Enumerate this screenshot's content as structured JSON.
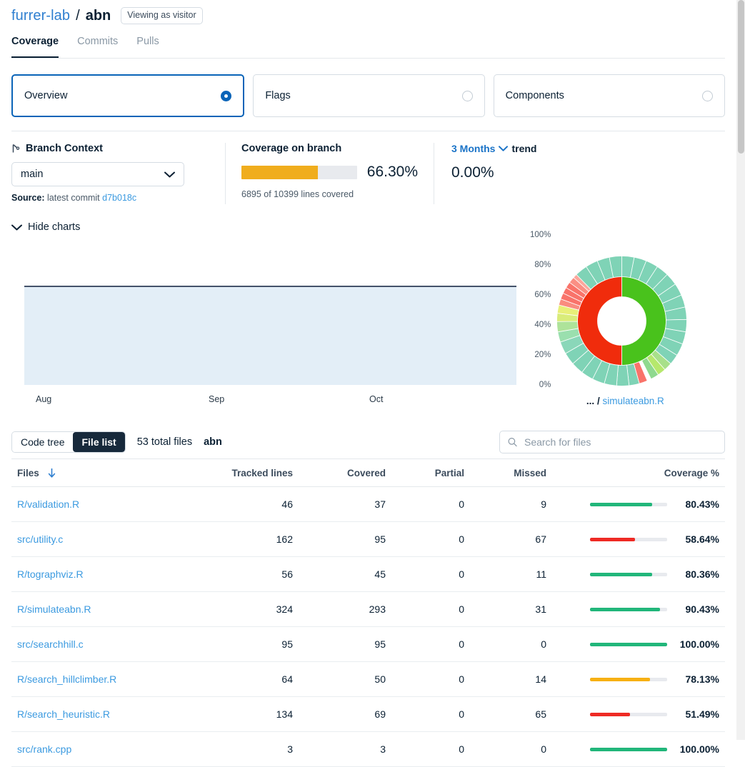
{
  "header": {
    "owner": "furrer-lab",
    "separator": "/",
    "repo": "abn",
    "visitor_badge": "Viewing as visitor"
  },
  "tabs": [
    {
      "label": "Coverage",
      "active": true
    },
    {
      "label": "Commits",
      "active": false
    },
    {
      "label": "Pulls",
      "active": false
    }
  ],
  "view_cards": [
    {
      "label": "Overview",
      "selected": true
    },
    {
      "label": "Flags",
      "selected": false
    },
    {
      "label": "Components",
      "selected": false
    }
  ],
  "branch_context": {
    "title": "Branch Context",
    "icon": "branch-icon",
    "selected_branch": "main",
    "source_label": "Source:",
    "source_text": "latest commit",
    "commit_sha": "d7b018c"
  },
  "coverage_on_branch": {
    "title": "Coverage on branch",
    "percent_label": "66.30%",
    "percent_value": 66.3,
    "lines_text": "6895 of 10399 lines covered",
    "bar_color": "#f0ad1d"
  },
  "trend": {
    "range_label": "3 Months",
    "suffix": "trend",
    "value": "0.00%"
  },
  "charts_toggle": {
    "label": "Hide charts"
  },
  "chart_data": [
    {
      "type": "area",
      "title": "",
      "x": [
        "Aug",
        "Sep",
        "Oct"
      ],
      "values": [
        66.3,
        66.3,
        66.3
      ],
      "ylabel": "",
      "xlabel": "",
      "ylim": [
        0,
        100
      ],
      "yticks": [
        "0%",
        "20%",
        "40%",
        "60%",
        "80%",
        "100%"
      ],
      "ytick_values": [
        0,
        20,
        40,
        60,
        80,
        100
      ],
      "grid": false,
      "legend": "none",
      "line_color": "#44526a",
      "fill_color": "#e3eef7"
    },
    {
      "type": "pie",
      "subtype": "sunburst",
      "title": "",
      "label_prefix": "...",
      "label_separator": "/",
      "label_file": "simulateabn.R",
      "rings": [
        {
          "name": "inner",
          "segments": [
            {
              "label": "covered",
              "value": 50,
              "color": "#49c21c"
            },
            {
              "label": "missed",
              "value": 50,
              "color": "#f02c0c"
            }
          ]
        },
        {
          "name": "outer",
          "segments": [
            {
              "label": "file",
              "value": 3.0,
              "color": "#7fd3b6"
            },
            {
              "label": "file",
              "value": 3.0,
              "color": "#7fd3b6"
            },
            {
              "label": "file",
              "value": 3.0,
              "color": "#7fd3b6"
            },
            {
              "label": "file",
              "value": 3.0,
              "color": "#7fd3b6"
            },
            {
              "label": "file",
              "value": 3.0,
              "color": "#7fd3b6"
            },
            {
              "label": "file",
              "value": 3.0,
              "color": "#7fd3b6"
            },
            {
              "label": "file",
              "value": 3.0,
              "color": "#7fd3b6"
            },
            {
              "label": "file",
              "value": 3.0,
              "color": "#7fd3b6"
            },
            {
              "label": "file",
              "value": 3.0,
              "color": "#7fd3b6"
            },
            {
              "label": "file",
              "value": 3.0,
              "color": "#7fd3b6"
            },
            {
              "label": "file",
              "value": 3.0,
              "color": "#7fd3b6"
            },
            {
              "label": "file",
              "value": 2.5,
              "color": "#7fd3b6"
            },
            {
              "label": "file",
              "value": 2.0,
              "color": "#a8e08a"
            },
            {
              "label": "file",
              "value": 2.0,
              "color": "#b6e86d"
            },
            {
              "label": "file",
              "value": 2.0,
              "color": "#8fd98f"
            },
            {
              "label": "gap",
              "value": 1.0,
              "color": "#ffffff"
            },
            {
              "label": "file",
              "value": 2.0,
              "color": "#f9736a"
            },
            {
              "label": "file",
              "value": 2.5,
              "color": "#7fd3b6"
            },
            {
              "label": "file",
              "value": 3.0,
              "color": "#7fd3b6"
            },
            {
              "label": "file",
              "value": 3.0,
              "color": "#7fd3b6"
            },
            {
              "label": "file",
              "value": 3.0,
              "color": "#7fd3b6"
            },
            {
              "label": "file",
              "value": 3.0,
              "color": "#7fd3b6"
            },
            {
              "label": "file",
              "value": 3.0,
              "color": "#7fd3b6"
            },
            {
              "label": "file",
              "value": 3.0,
              "color": "#7fd3b6"
            },
            {
              "label": "file",
              "value": 3.0,
              "color": "#8ad7b9"
            },
            {
              "label": "file",
              "value": 2.5,
              "color": "#9adfae"
            },
            {
              "label": "file",
              "value": 2.5,
              "color": "#aee39a"
            },
            {
              "label": "file",
              "value": 2.0,
              "color": "#d9ec7a"
            },
            {
              "label": "file",
              "value": 2.0,
              "color": "#e8ef78"
            },
            {
              "label": "file",
              "value": 1.5,
              "color": "#f98c7f"
            },
            {
              "label": "file",
              "value": 1.5,
              "color": "#f9736a"
            },
            {
              "label": "file",
              "value": 1.5,
              "color": "#f9736a"
            },
            {
              "label": "file",
              "value": 1.5,
              "color": "#f9736a"
            },
            {
              "label": "file",
              "value": 1.5,
              "color": "#fa8f84"
            },
            {
              "label": "file",
              "value": 1.0,
              "color": "#fba79c"
            },
            {
              "label": "file",
              "value": 3.0,
              "color": "#7fd3b6"
            },
            {
              "label": "file",
              "value": 3.0,
              "color": "#7fd3b6"
            },
            {
              "label": "file",
              "value": 3.0,
              "color": "#7fd3b6"
            },
            {
              "label": "file",
              "value": 3.0,
              "color": "#7fd3b6"
            }
          ]
        }
      ]
    }
  ],
  "file_list_controls": {
    "code_tree_label": "Code tree",
    "file_list_label": "File list",
    "active": "File list",
    "total_files": "53 total files",
    "breadcrumb": "abn",
    "search_placeholder": "Search for files",
    "search_value": ""
  },
  "table": {
    "columns": [
      {
        "key": "file",
        "label": "Files",
        "sorted": true,
        "sort_dir": "desc"
      },
      {
        "key": "tracked",
        "label": "Tracked lines"
      },
      {
        "key": "covered",
        "label": "Covered"
      },
      {
        "key": "partial",
        "label": "Partial"
      },
      {
        "key": "missed",
        "label": "Missed"
      },
      {
        "key": "coverage",
        "label": "Coverage %"
      }
    ],
    "rows": [
      {
        "file": "R/validation.R",
        "tracked": "46",
        "covered": "37",
        "partial": "0",
        "missed": "9",
        "pct": "80.43%",
        "pct_value": 80.43,
        "bar_color": "#21b67a"
      },
      {
        "file": "src/utility.c",
        "tracked": "162",
        "covered": "95",
        "partial": "0",
        "missed": "67",
        "pct": "58.64%",
        "pct_value": 58.64,
        "bar_color": "#ee2a24"
      },
      {
        "file": "R/tographviz.R",
        "tracked": "56",
        "covered": "45",
        "partial": "0",
        "missed": "11",
        "pct": "80.36%",
        "pct_value": 80.36,
        "bar_color": "#21b67a"
      },
      {
        "file": "R/simulateabn.R",
        "tracked": "324",
        "covered": "293",
        "partial": "0",
        "missed": "31",
        "pct": "90.43%",
        "pct_value": 90.43,
        "bar_color": "#21b67a"
      },
      {
        "file": "src/searchhill.c",
        "tracked": "95",
        "covered": "95",
        "partial": "0",
        "missed": "0",
        "pct": "100.00%",
        "pct_value": 100,
        "bar_color": "#21b67a"
      },
      {
        "file": "R/search_hillclimber.R",
        "tracked": "64",
        "covered": "50",
        "partial": "0",
        "missed": "14",
        "pct": "78.13%",
        "pct_value": 78.13,
        "bar_color": "#f7b013"
      },
      {
        "file": "R/search_heuristic.R",
        "tracked": "134",
        "covered": "69",
        "partial": "0",
        "missed": "65",
        "pct": "51.49%",
        "pct_value": 51.49,
        "bar_color": "#ee2a24"
      },
      {
        "file": "src/rank.cpp",
        "tracked": "3",
        "covered": "3",
        "partial": "0",
        "missed": "0",
        "pct": "100.00%",
        "pct_value": 100,
        "bar_color": "#21b67a"
      }
    ]
  },
  "colors": {
    "link": "#3b9ae0",
    "accent_blue": "#0a64b8",
    "green": "#21b67a",
    "red": "#ee2a24",
    "orange": "#f7b013",
    "dark": "#17293b"
  }
}
